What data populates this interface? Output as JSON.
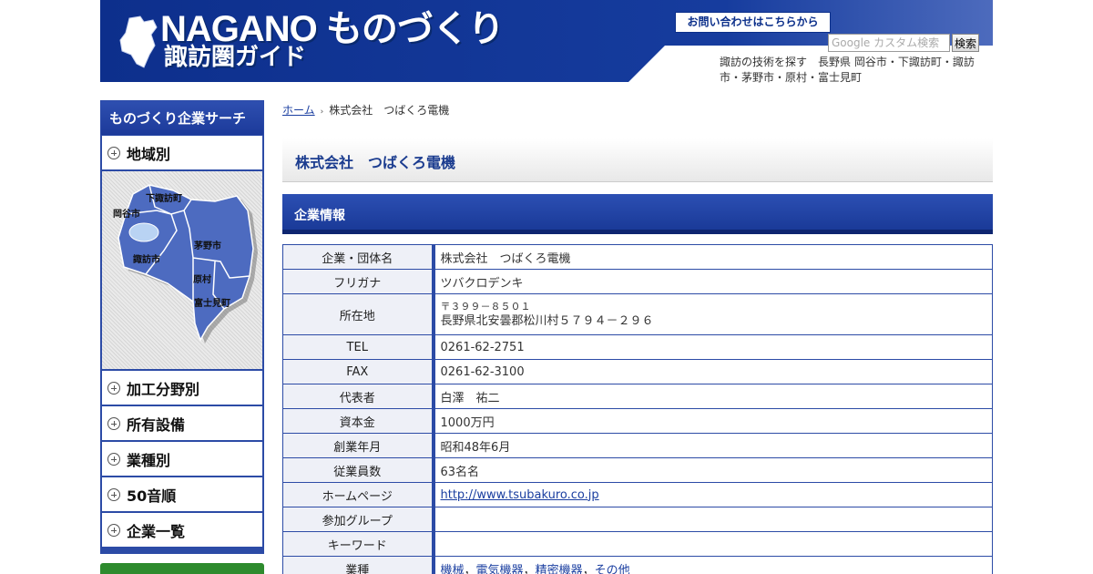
{
  "header": {
    "logo_en": "NAGANO ものづくり",
    "logo_jp": "諏訪圏ガイド",
    "contact_label": "お問い合わせはこちらから",
    "search_placeholder": "Google カスタム検索",
    "search_button": "検索",
    "tagline": "諏訪の技術を探す　長野県 岡谷市・下諏訪町・諏訪市・茅野市・原村・富士見町"
  },
  "sidebar": {
    "title": "ものづくり企業サーチ",
    "items": [
      {
        "label": "地域別"
      },
      {
        "label": "加工分野別"
      },
      {
        "label": "所有設備"
      },
      {
        "label": "業種別"
      },
      {
        "label": "50音順"
      },
      {
        "label": "企業一覧"
      }
    ],
    "map_labels": {
      "okaya": "岡谷市",
      "shimosuwa": "下諏訪町",
      "suwa": "諏訪市",
      "chino": "茅野市",
      "hara": "原村",
      "fujimi": "富士見町"
    }
  },
  "breadcrumb": {
    "home": "ホーム",
    "current": "株式会社　つばくろ電機"
  },
  "page_title": "株式会社　つばくろ電機",
  "section_title": "企業情報",
  "company": {
    "name_label": "企業・団体名",
    "name": "株式会社　つばくろ電機",
    "kana_label": "フリガナ",
    "kana": "ツバクロデンキ",
    "address_label": "所在地",
    "zip": "〒３９９－８５０１",
    "address": "長野県北安曇郡松川村５７９４－２９６",
    "tel_label": "TEL",
    "tel": "0261-62-2751",
    "fax_label": "FAX",
    "fax": "0261-62-3100",
    "rep_label": "代表者",
    "rep": "白澤　祐二",
    "capital_label": "資本金",
    "capital": "1000万円",
    "founded_label": "創業年月",
    "founded": "昭和48年6月",
    "employees_label": "従業員数",
    "employees": "63名名",
    "homepage_label": "ホームページ",
    "homepage": "http://www.tsubakuro.co.jp",
    "group_label": "参加グループ",
    "keyword_label": "キーワード",
    "industry_label": "業種",
    "industries": [
      "機械",
      "電気機器",
      "精密機器",
      "その他"
    ]
  }
}
